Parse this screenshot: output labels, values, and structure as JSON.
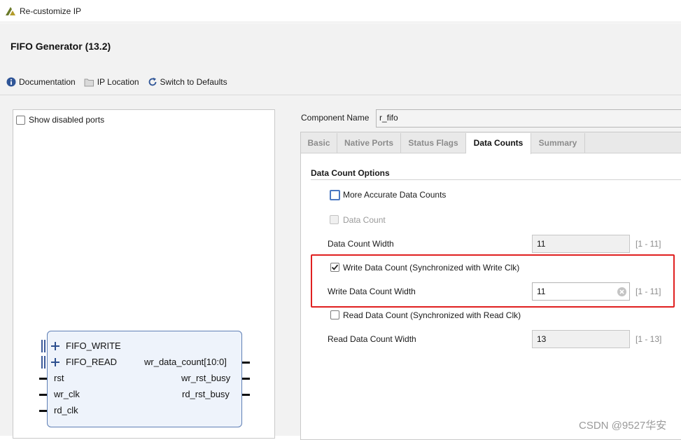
{
  "window": {
    "title": "Re-customize IP"
  },
  "ip": {
    "name": "FIFO Generator (13.2)"
  },
  "toolbar": {
    "documentation": "Documentation",
    "ip_location": "IP Location",
    "switch_defaults": "Switch to Defaults"
  },
  "left": {
    "show_disabled_ports": "Show disabled ports",
    "ports_left": [
      "FIFO_WRITE",
      "FIFO_READ",
      "rst",
      "wr_clk",
      "rd_clk"
    ],
    "ports_right": [
      "wr_data_count[10:0]",
      "wr_rst_busy",
      "rd_rst_busy"
    ]
  },
  "component": {
    "label": "Component Name",
    "value": "r_fifo"
  },
  "tabs": [
    "Basic",
    "Native Ports",
    "Status Flags",
    "Data Counts",
    "Summary"
  ],
  "active_tab": "Data Counts",
  "section": {
    "title": "Data Count Options",
    "more_accurate": "More Accurate Data Counts",
    "data_count": "Data Count",
    "data_count_width_label": "Data Count Width",
    "data_count_width_value": "11",
    "data_count_width_range": "[1 - 11]",
    "write_data_count": "Write Data Count (Synchronized with Write Clk)",
    "write_data_count_width_label": "Write Data Count Width",
    "write_data_count_width_value": "11",
    "write_data_count_width_range": "[1 - 11]",
    "read_data_count": "Read Data Count (Synchronized with Read Clk)",
    "read_data_count_width_label": "Read Data Count Width",
    "read_data_count_width_value": "13",
    "read_data_count_width_range": "[1 - 13]"
  },
  "watermark": "CSDN @9527华安",
  "colors": {
    "accent": "#2d4f8e",
    "highlight_border": "#e02020"
  }
}
